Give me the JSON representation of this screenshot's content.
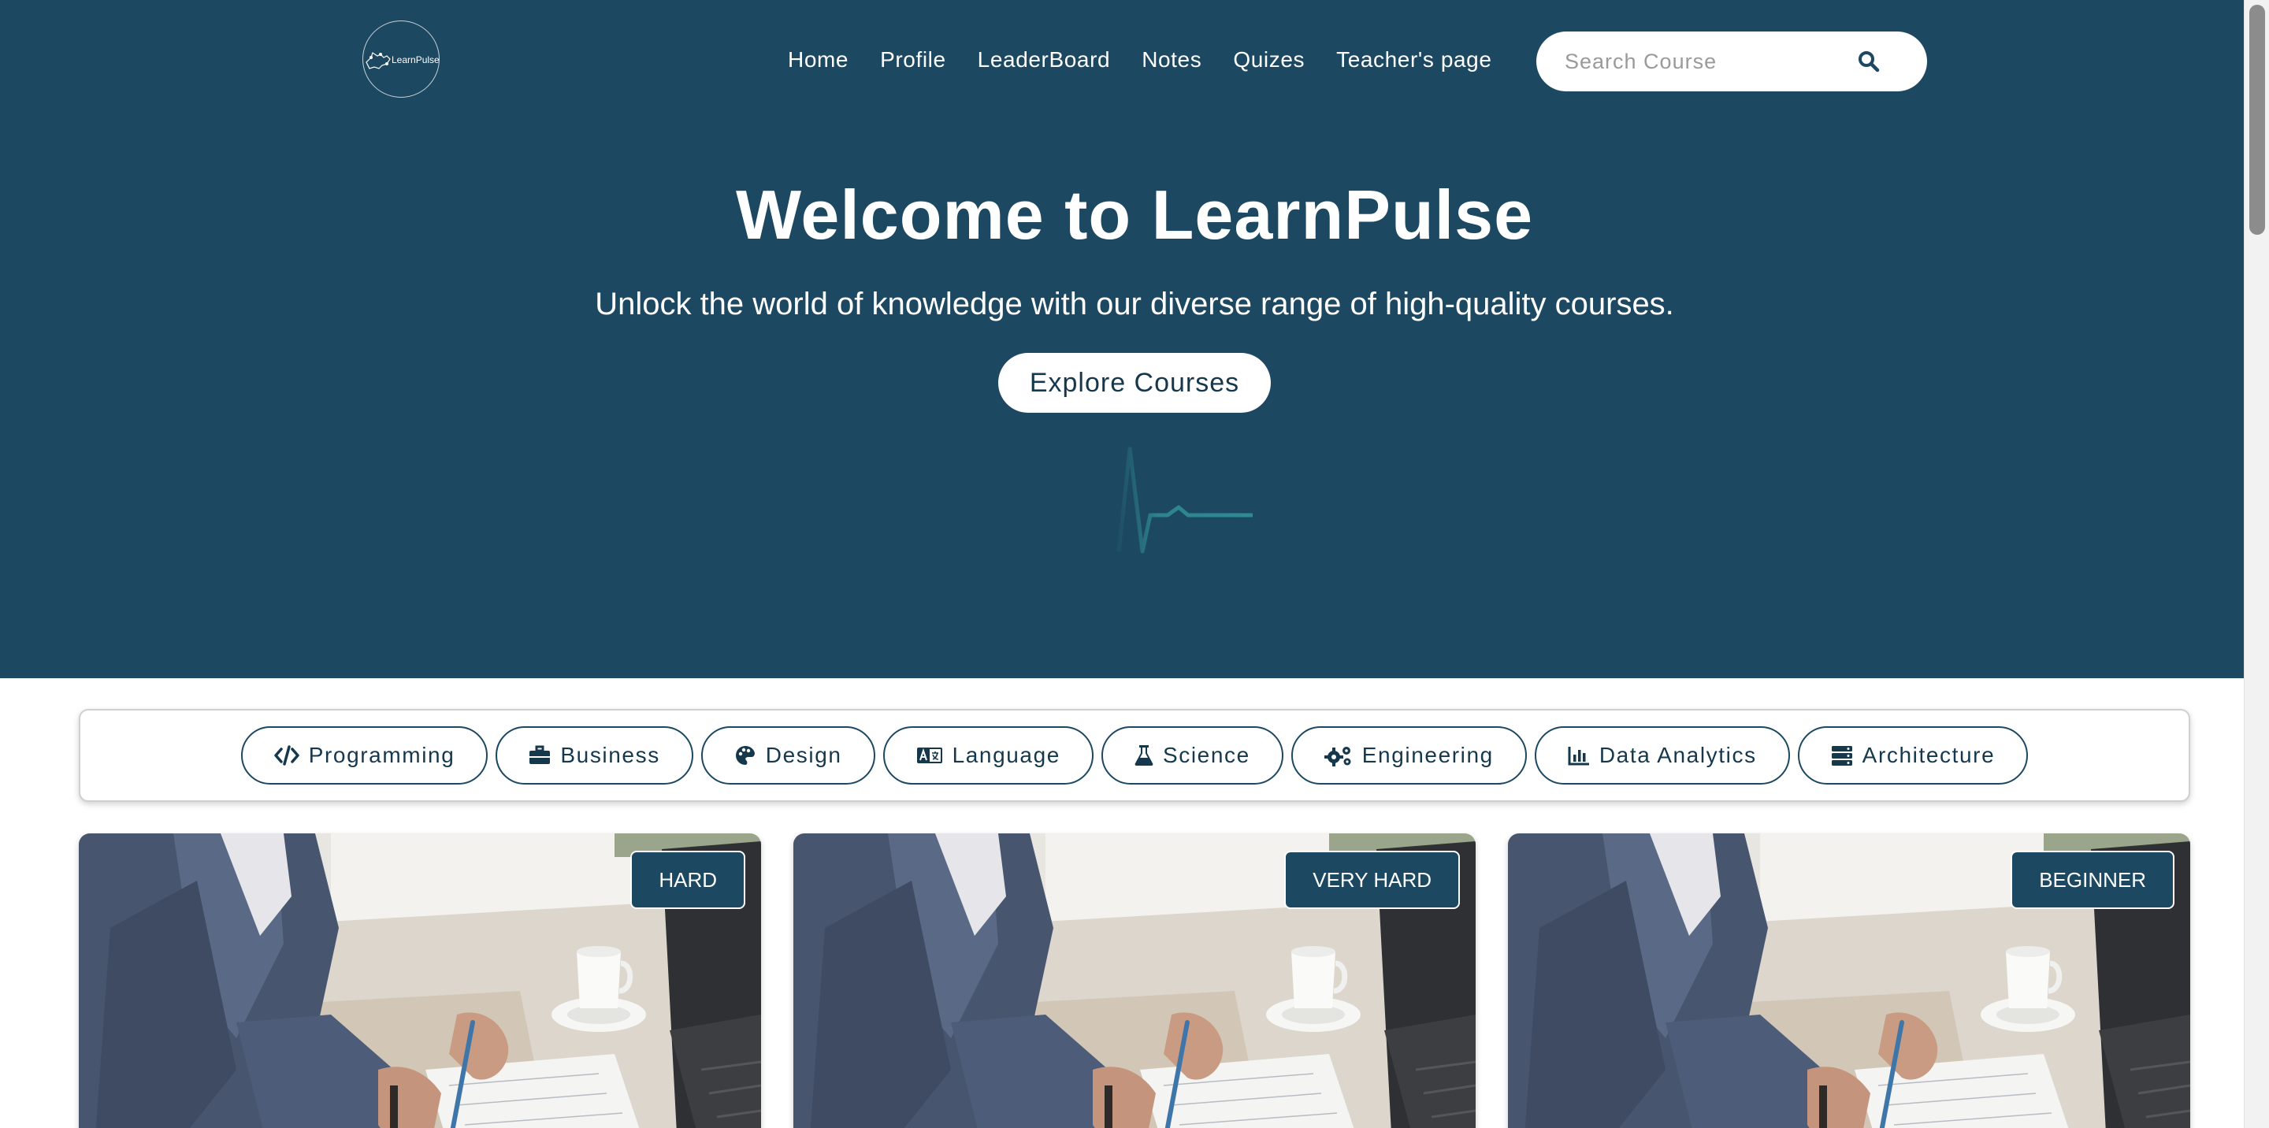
{
  "brand": {
    "logo_text": "LearnPulse"
  },
  "nav": {
    "items": [
      {
        "label": "Home"
      },
      {
        "label": "Profile"
      },
      {
        "label": "LeaderBoard"
      },
      {
        "label": "Notes"
      },
      {
        "label": "Quizes"
      },
      {
        "label": "Teacher's page"
      }
    ]
  },
  "search": {
    "placeholder": "Search Course",
    "value": ""
  },
  "hero": {
    "title": "Welcome to LearnPulse",
    "subtitle": "Unlock the world of knowledge with our diverse range of high-quality courses.",
    "cta_label": "Explore Courses"
  },
  "categories": [
    {
      "label": "Programming",
      "icon": "code-icon"
    },
    {
      "label": "Business",
      "icon": "briefcase-icon"
    },
    {
      "label": "Design",
      "icon": "palette-icon"
    },
    {
      "label": "Language",
      "icon": "language-icon"
    },
    {
      "label": "Science",
      "icon": "flask-icon"
    },
    {
      "label": "Engineering",
      "icon": "gears-icon"
    },
    {
      "label": "Data Analytics",
      "icon": "chart-icon"
    },
    {
      "label": "Architecture",
      "icon": "server-icon"
    }
  ],
  "courses": [
    {
      "difficulty": "HARD"
    },
    {
      "difficulty": "VERY HARD"
    },
    {
      "difficulty": "BEGINNER"
    }
  ],
  "colors": {
    "primary": "#1d4862",
    "accent_pulse": "#2f8a96",
    "background": "#ffffff"
  }
}
